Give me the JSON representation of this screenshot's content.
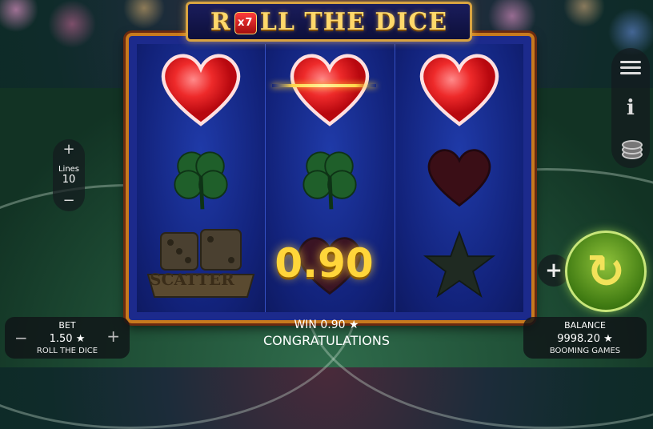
{
  "title": {
    "prefix": "R",
    "die_label": "x7",
    "suffix": "LL THE DICE"
  },
  "reels": [
    [
      "heart-red-glow",
      "clover-green",
      "dice-scatter"
    ],
    [
      "heart-red-glow",
      "clover-green",
      "heart-dark"
    ],
    [
      "heart-red-glow",
      "heart-dark",
      "star-dark"
    ]
  ],
  "scatter_label": "SCATTER",
  "win_display": "0.90",
  "lines": {
    "label": "Lines",
    "value": "10",
    "plus": "+",
    "minus": "−"
  },
  "bet": {
    "label": "BET",
    "value": "1.50 ★",
    "minus": "−",
    "plus": "+"
  },
  "game_name": "ROLL THE DICE",
  "message": {
    "win": "WIN 0.90 ★",
    "status": "CONGRATULATIONS"
  },
  "balance": {
    "label": "BALANCE",
    "value": "9998.20 ★"
  },
  "provider": "BOOMING GAMES",
  "colors": {
    "reel_bg": "#12227a",
    "frame": "#c77a1e",
    "heart_red": "#e8232b",
    "clover": "#1f5f2a",
    "win_gold": "#ffd53a",
    "spin_green": "#4f8a1a"
  }
}
